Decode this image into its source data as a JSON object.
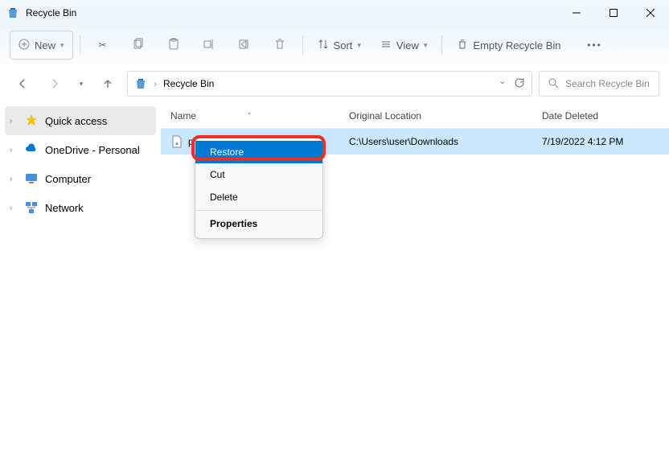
{
  "window": {
    "title": "Recycle Bin"
  },
  "toolbar": {
    "new_label": "New",
    "sort_label": "Sort",
    "view_label": "View",
    "empty_label": "Empty Recycle Bin"
  },
  "breadcrumb": {
    "current": "Recycle Bin"
  },
  "search": {
    "placeholder": "Search Recycle Bin"
  },
  "sidebar": {
    "items": [
      {
        "label": "Quick access"
      },
      {
        "label": "OneDrive - Personal"
      },
      {
        "label": "Computer"
      },
      {
        "label": "Network"
      }
    ]
  },
  "columns": {
    "name": "Name",
    "original": "Original Location",
    "deleted": "Date Deleted"
  },
  "files": [
    {
      "name_visible": "p",
      "original_location": "C:\\Users\\user\\Downloads",
      "date_deleted": "7/19/2022 4:12 PM"
    }
  ],
  "context_menu": {
    "restore": "Restore",
    "cut": "Cut",
    "delete": "Delete",
    "properties": "Properties"
  }
}
